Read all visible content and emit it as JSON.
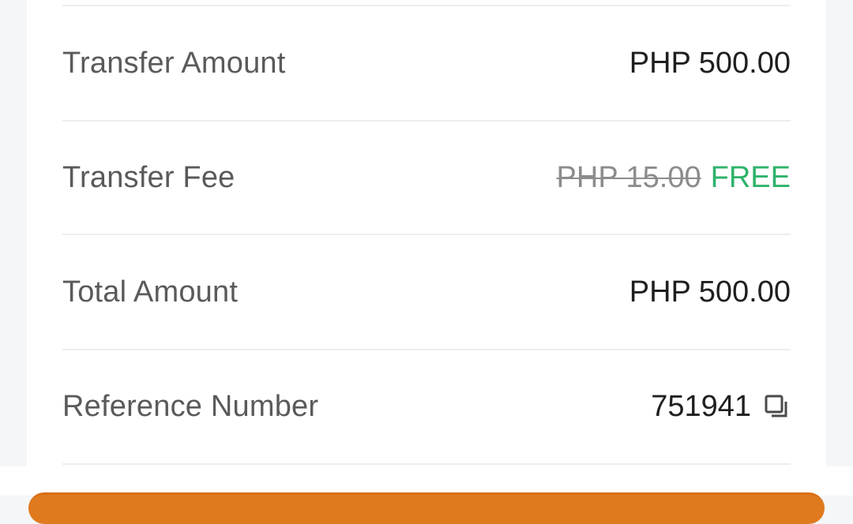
{
  "summary": {
    "rows": [
      {
        "label": "Transfer Amount",
        "value": "PHP 500.00"
      },
      {
        "label": "Transfer Fee",
        "original_value": "PHP 15.00",
        "value": "FREE"
      },
      {
        "label": "Total Amount",
        "value": "PHP 500.00"
      },
      {
        "label": "Reference Number",
        "value": "751941"
      }
    ]
  },
  "icons": {
    "copy": "copy-icon"
  },
  "colors": {
    "free_text": "#2eb36b",
    "strike_text": "#8c8c8c",
    "label_text": "#5a5a5a",
    "value_text": "#1f1f1f",
    "action_button": "#e07a1f"
  }
}
